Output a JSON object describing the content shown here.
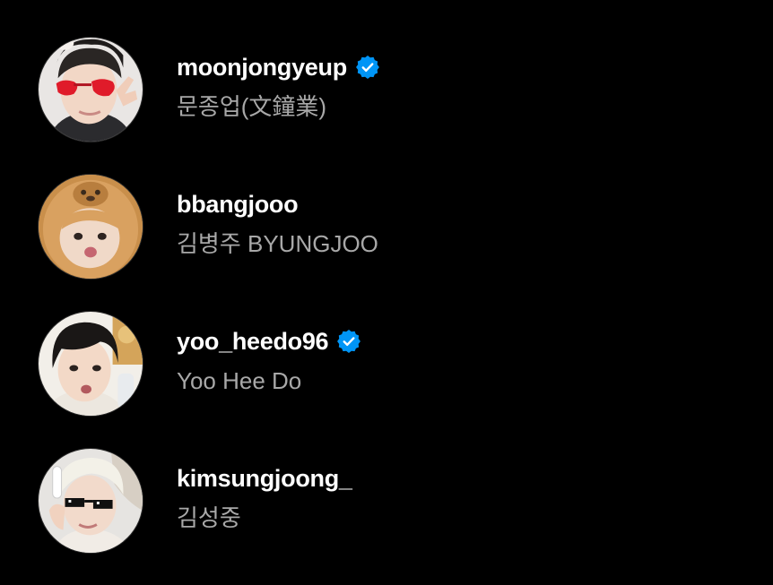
{
  "accounts": [
    {
      "username": "moonjongyeup",
      "full_name": "문종업(文鐘業)",
      "verified": true,
      "avatar_icon": "avatar-photo-red-sunglasses"
    },
    {
      "username": "bbangjooo",
      "full_name": "김병주 BYUNGJOO",
      "verified": false,
      "avatar_icon": "avatar-photo-bear-hat"
    },
    {
      "username": "yoo_heedo96",
      "full_name": "Yoo Hee Do",
      "verified": true,
      "avatar_icon": "avatar-photo-dark-hair"
    },
    {
      "username": "kimsungjoong_",
      "full_name": "김성중",
      "verified": false,
      "avatar_icon": "avatar-photo-pixel-sunglasses"
    }
  ],
  "colors": {
    "background": "#000000",
    "username": "#ffffff",
    "full_name": "#a8a8a8",
    "verified_badge": "#0095f6"
  },
  "icons": {
    "verified_badge": "verified-badge-icon"
  }
}
